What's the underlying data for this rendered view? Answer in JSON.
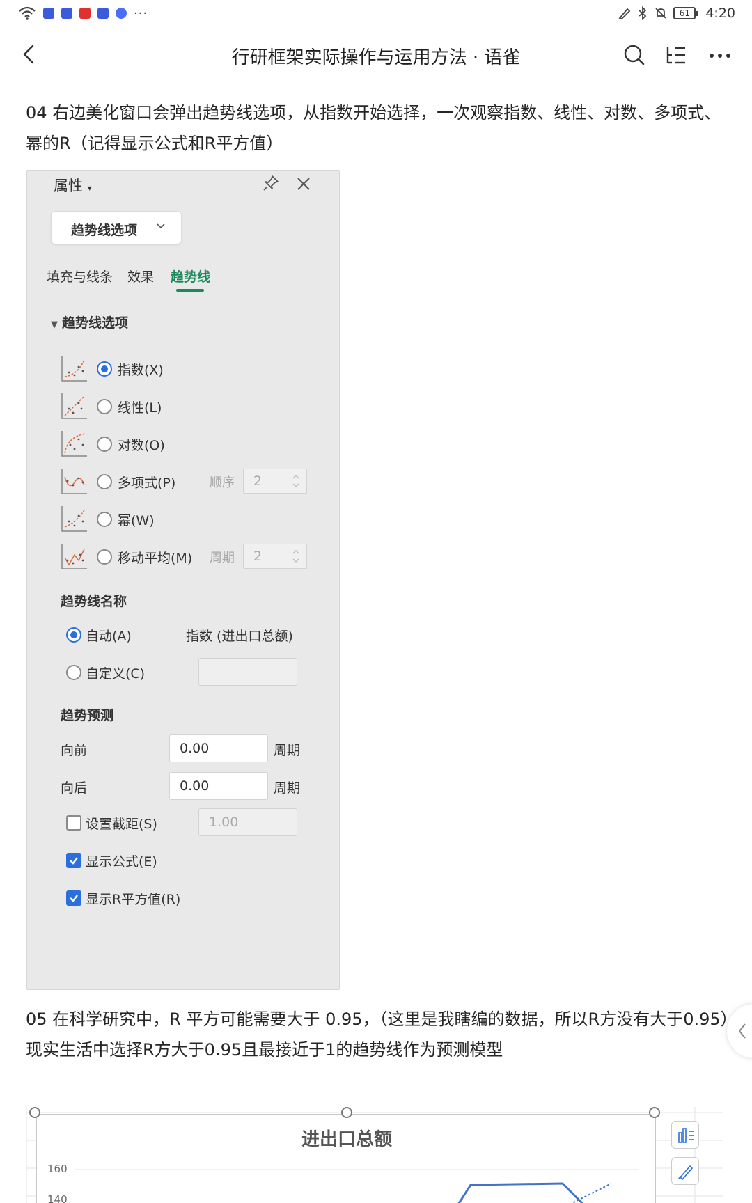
{
  "status_bar": {
    "time": "4:20",
    "battery": "61"
  },
  "nav": {
    "title": "行研框架实际操作与运用方法 · 语雀"
  },
  "article": {
    "step4": "04 右边美化窗口会弹出趋势线选项，从指数开始选择，一次观察指数、线性、对数、多项式、幂的R（记得显示公式和R平方值）",
    "step5": "05 在科学研究中，R 平方可能需要大于 0.95，（这里是我瞎编的数据，所以R方没有大于0.95）现实生活中选择R方大于0.95且最接近于1的趋势线作为预测模型"
  },
  "panel": {
    "header": "属性",
    "dropdown": "趋势线选项",
    "tabs": [
      "填充与线条",
      "效果",
      "趋势线"
    ],
    "section": "趋势线选项",
    "types": [
      {
        "label": "指数(X)",
        "selected": true
      },
      {
        "label": "线性(L)",
        "selected": false
      },
      {
        "label": "对数(O)",
        "selected": false
      },
      {
        "label": "多项式(P)",
        "selected": false,
        "extra_label": "顺序",
        "extra_value": "2"
      },
      {
        "label": "幂(W)",
        "selected": false
      },
      {
        "label": "移动平均(M)",
        "selected": false,
        "extra_label": "周期",
        "extra_value": "2"
      }
    ],
    "name_section": "趋势线名称",
    "name_auto": "自动(A)",
    "name_auto_value": "指数 (进出口总额)",
    "name_custom": "自定义(C)",
    "forecast_section": "趋势预测",
    "forward_label": "向前",
    "forward_value": "0.00",
    "backward_label": "向后",
    "backward_value": "0.00",
    "period_unit": "周期",
    "intercept_label": "设置截距(S)",
    "intercept_value": "1.00",
    "show_formula": "显示公式(E)",
    "show_r2": "显示R平方值(R)"
  },
  "chart_data": {
    "type": "line",
    "title": "进出口总额",
    "y_ticks": [
      "160",
      "140"
    ],
    "series": [],
    "note_colors": {
      "line": "#4472c4",
      "trend": "#4472c4"
    }
  }
}
